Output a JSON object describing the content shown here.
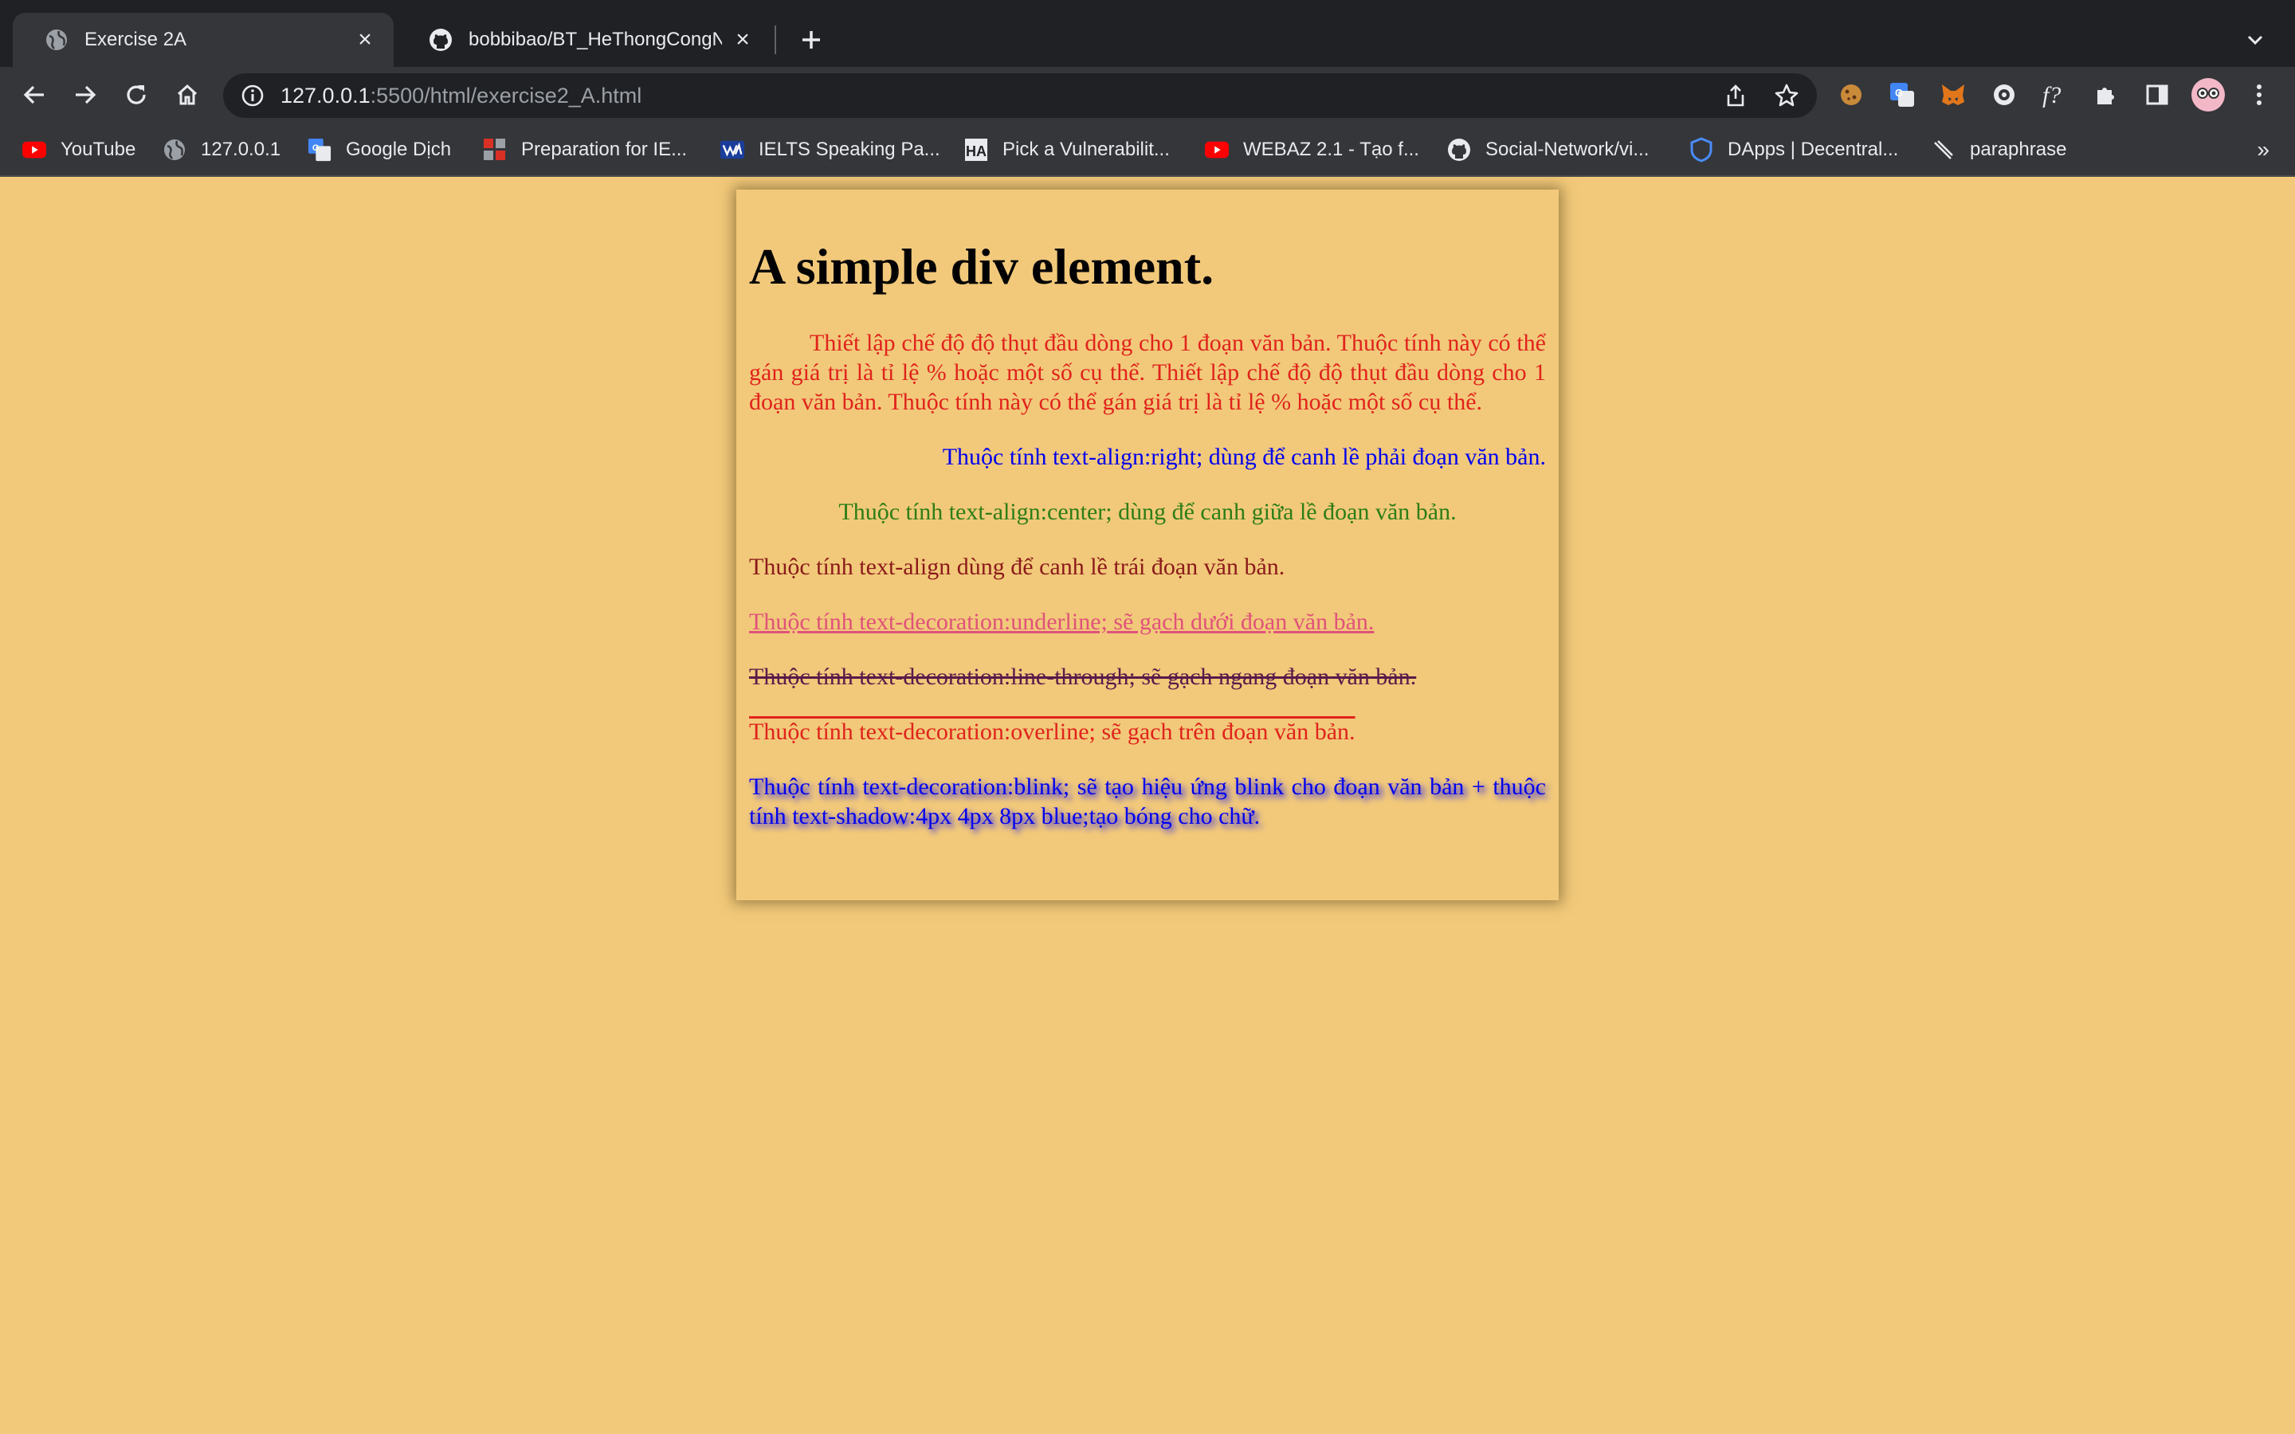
{
  "browser": {
    "tabs": [
      {
        "title": "Exercise 2A",
        "active": true
      },
      {
        "title": "bobbibao/BT_HeThongCongNg",
        "active": false
      }
    ],
    "url": {
      "host": "127.0.0.1",
      "rest": ":5500/html/exercise2_A.html"
    },
    "bookmarks": [
      {
        "label": "YouTube",
        "icon": "youtube-icon"
      },
      {
        "label": "127.0.0.1",
        "icon": "globe-icon"
      },
      {
        "label": "Google Dịch",
        "icon": "google-translate-icon"
      },
      {
        "label": "Preparation for IE...",
        "icon": "grid-icon"
      },
      {
        "label": "IELTS Speaking Pa...",
        "icon": "ielts-icon"
      },
      {
        "label": "Pick a Vulnerabilit...",
        "icon": "ha-icon"
      },
      {
        "label": "WEBAZ 2.1 - Tạo f...",
        "icon": "youtube-icon"
      },
      {
        "label": "Social-Network/vi...",
        "icon": "github-icon"
      },
      {
        "label": "DApps | Decentral...",
        "icon": "shield-icon"
      },
      {
        "label": "paraphrase",
        "icon": "quill-icon"
      }
    ],
    "more_bookmarks": "»"
  },
  "page": {
    "heading": "A simple div element.",
    "p_indent": "Thiết lập chế độ độ thụt đầu dòng cho 1 đoạn văn bản. Thuộc tính này có thể gán giá trị là tỉ lệ % hoặc một số cụ thể. Thiết lập chế độ độ thụt đầu dòng cho 1 đoạn văn bản. Thuộc tính này có thể gán giá trị là tỉ lệ % hoặc một số cụ thể.",
    "p_right": "Thuộc tính text-align:right; dùng để canh lề phải đoạn văn bản.",
    "p_center": "Thuộc tính text-align:center; dùng để canh giữa lề đoạn văn bản.",
    "p_left": "Thuộc tính text-align dùng để canh lề trái đoạn văn bản.",
    "p_underline": "Thuộc tính text-decoration:underline; sẽ gạch dưới đoạn văn bản.",
    "p_linethrough": "Thuộc tính text-decoration:line-through; sẽ gạch ngang đoạn văn bản.",
    "p_overline": "Thuộc tính text-decoration:overline; sẽ gạch trên đoạn văn bản.",
    "p_blink": "Thuộc tính text-decoration:blink; sẽ tạo hiệu ứng blink cho đoạn văn bản + thuộc tính text-shadow:4px 4px 8px blue;tạo bóng cho chữ."
  },
  "colors": {
    "background": "#f2c97a",
    "chrome_dark": "#202124",
    "chrome": "#35363a"
  }
}
